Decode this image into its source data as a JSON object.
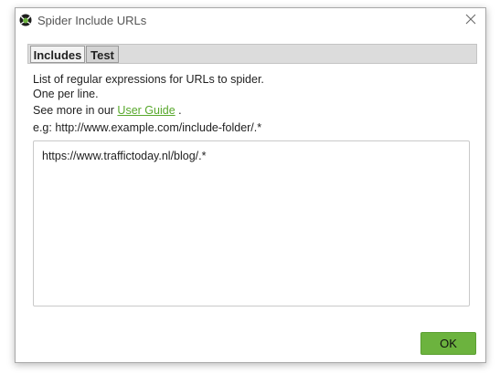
{
  "window": {
    "title": "Spider Include URLs",
    "app_icon": "spider-icon",
    "close_icon": "close-icon"
  },
  "tabs": [
    {
      "label": "Includes",
      "active": true
    },
    {
      "label": "Test",
      "active": false
    }
  ],
  "info": {
    "line1": "List of regular expressions for URLs to spider.",
    "line2": "One per line.",
    "see_more_prefix": "See more in our",
    "user_guide_link": "User Guide",
    "see_more_suffix": ".",
    "example": "e.g: http://www.example.com/include-folder/.*"
  },
  "editor": {
    "value": "https://www.traffictoday.nl/blog/.*"
  },
  "buttons": {
    "ok": "OK"
  },
  "colors": {
    "accent_green": "#6cb33e",
    "link_green": "#58a82c"
  }
}
